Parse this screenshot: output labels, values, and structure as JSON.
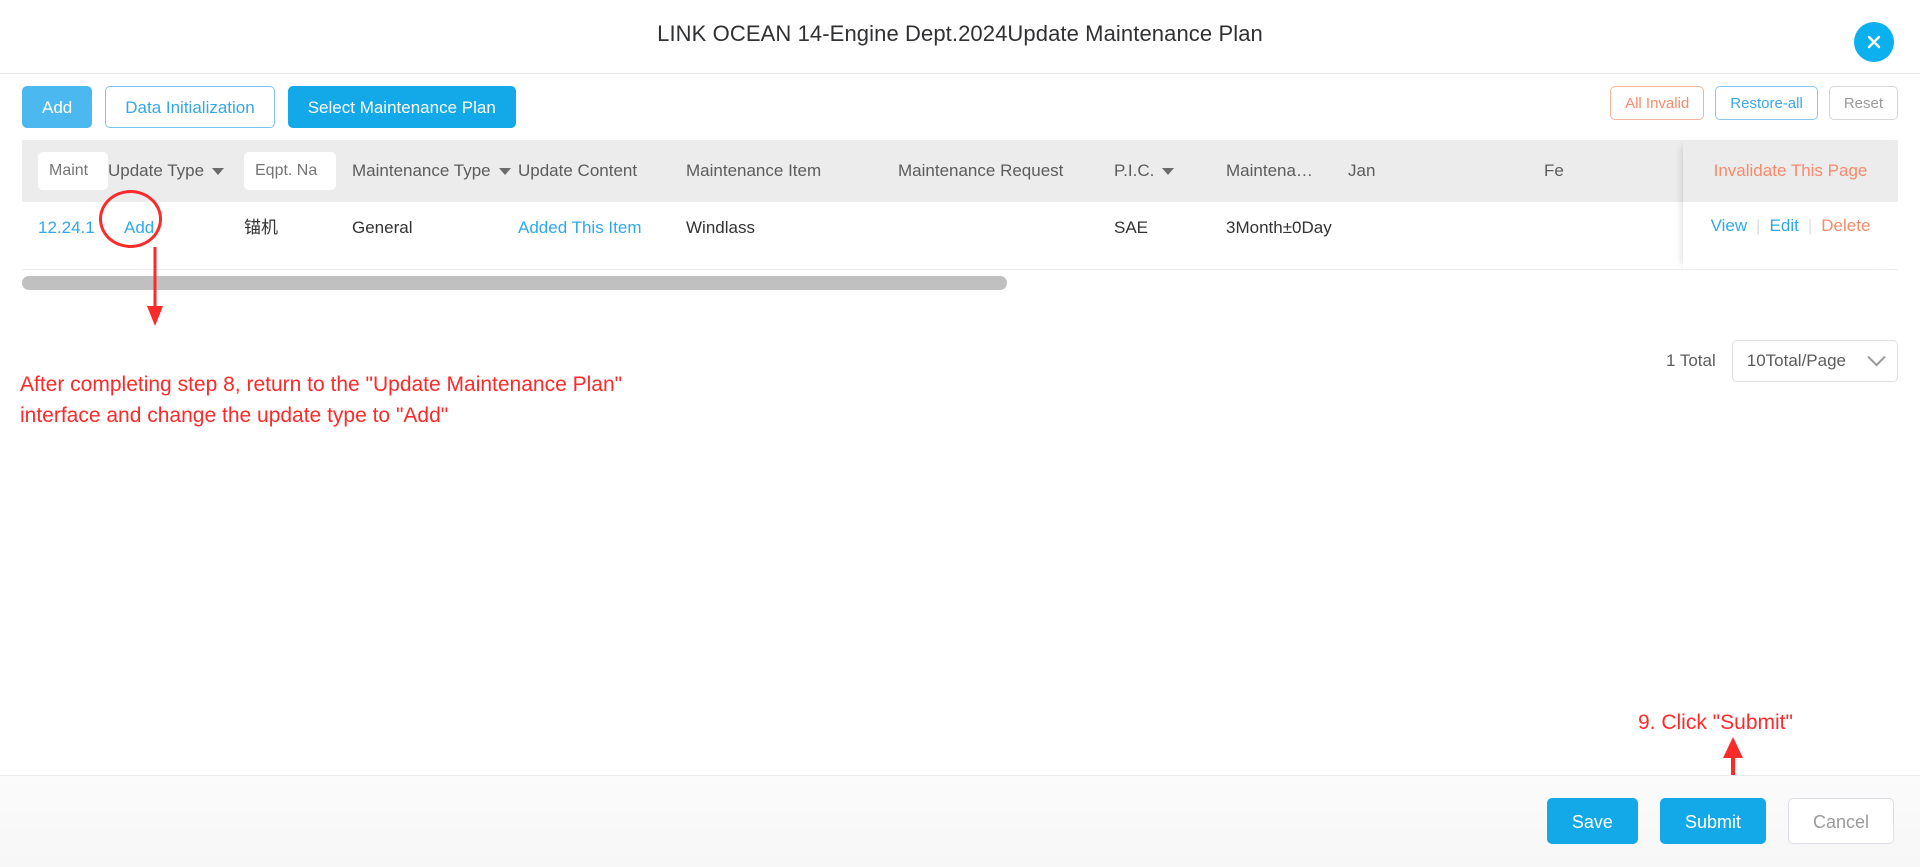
{
  "dialog": {
    "title": "LINK OCEAN 14-Engine Dept.2024Update Maintenance Plan",
    "close_icon": "close-icon"
  },
  "toolbar": {
    "add_label": "Add",
    "data_init_label": "Data Initialization",
    "select_plan_label": "Select Maintenance Plan",
    "all_invalid_label": "All Invalid",
    "restore_all_label": "Restore-all",
    "reset_label": "Reset"
  },
  "table": {
    "columns": [
      {
        "key": "maint_no",
        "label": "",
        "placeholder": "Maint",
        "type": "input"
      },
      {
        "key": "update_type",
        "label": "Update Type",
        "type": "filter"
      },
      {
        "key": "eqpt_name",
        "label": "",
        "placeholder": "Eqpt. Na",
        "type": "input"
      },
      {
        "key": "maintenance_type",
        "label": "Maintenance Type",
        "type": "filter"
      },
      {
        "key": "update_content",
        "label": "Update Content",
        "type": "plain"
      },
      {
        "key": "maintenance_item",
        "label": "Maintenance Item",
        "type": "plain"
      },
      {
        "key": "maintenance_request",
        "label": "Maintenance Request",
        "type": "plain"
      },
      {
        "key": "pic",
        "label": "P.I.C.",
        "type": "filter"
      },
      {
        "key": "maintenance_interval",
        "label": "Maintena…",
        "type": "plain"
      },
      {
        "key": "jan",
        "label": "Jan",
        "type": "plain"
      },
      {
        "key": "feb",
        "label": "Fe",
        "type": "plain"
      }
    ],
    "fixed_column": {
      "header_label": "Invalidate This Page",
      "actions": [
        "View",
        "Edit",
        "Delete"
      ],
      "separator": "|"
    },
    "rows": [
      {
        "maint_no": "12.24.1",
        "update_type": "Add",
        "eqpt_name": "锚机",
        "maintenance_type": "General",
        "update_content": "Added This Item",
        "maintenance_item": "Windlass",
        "maintenance_request": "",
        "pic": "SAE",
        "maintenance_interval": "3Month±0Day",
        "jan": "",
        "feb": ""
      }
    ]
  },
  "pagination": {
    "total_label": "1 Total",
    "page_size_label": "10Total/Page"
  },
  "annotations": {
    "step8_note": "After completing step 8, return to the \"Update Maintenance Plan\"\ninterface and change the update type to \"Add\"",
    "step9_note": "9. Click \"Submit\""
  },
  "footer": {
    "save_label": "Save",
    "submit_label": "Submit",
    "cancel_label": "Cancel"
  },
  "colors": {
    "accent_blue": "#13a8e8",
    "light_blue": "#4cb8f0",
    "link_blue": "#2fa8ee",
    "danger_orange": "#f58b6a",
    "annotation_red": "#fc2b2b",
    "header_gray": "#ececec"
  }
}
